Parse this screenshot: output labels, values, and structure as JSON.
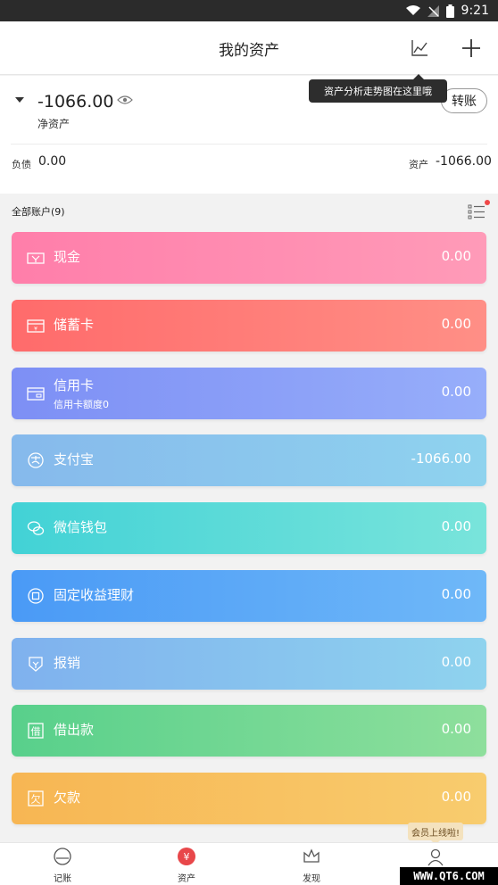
{
  "status_bar": {
    "time": "9:21"
  },
  "header": {
    "title": "我的资产"
  },
  "tooltip": {
    "text": "资产分析走势图在这里哦"
  },
  "summary": {
    "net_amount": "-1066.00",
    "net_label": "净资产",
    "transfer_label": "转账",
    "debt_label": "负债",
    "debt_value": "0.00",
    "asset_label": "资产",
    "asset_value": "-1066.00"
  },
  "accounts_header": {
    "title": "全部账户(9)"
  },
  "accounts": [
    {
      "name": "现金",
      "value": "0.00",
      "icon": "cash-icon",
      "color_start": "#ff7eaa",
      "color_end": "#ff9bb8"
    },
    {
      "name": "储蓄卡",
      "value": "0.00",
      "icon": "savings-card-icon",
      "color_start": "#ff6b6b",
      "color_end": "#ff8f86"
    },
    {
      "name": "信用卡",
      "subtitle": "信用卡额度0",
      "value": "0.00",
      "icon": "credit-card-icon",
      "color_start": "#7d8ff5",
      "color_end": "#97aefa"
    },
    {
      "name": "支付宝",
      "value": "-1066.00",
      "icon": "alipay-icon",
      "color_start": "#86b9ec",
      "color_end": "#8fd3ee"
    },
    {
      "name": "微信钱包",
      "value": "0.00",
      "icon": "wechat-icon",
      "color_start": "#42d2d6",
      "color_end": "#79e4db"
    },
    {
      "name": "固定收益理财",
      "value": "0.00",
      "icon": "fixed-income-icon",
      "color_start": "#4a9af6",
      "color_end": "#6fb8f8"
    },
    {
      "name": "报销",
      "value": "0.00",
      "icon": "reimburse-icon",
      "color_start": "#7fb1ee",
      "color_end": "#8fd3ee"
    },
    {
      "name": "借出款",
      "value": "0.00",
      "icon": "loan-out-icon",
      "color_start": "#58d08b",
      "color_end": "#8edf9c"
    },
    {
      "name": "欠款",
      "value": "0.00",
      "icon": "debt-icon",
      "color_start": "#f7b653",
      "color_end": "#f8cc6e"
    }
  ],
  "member_tip": {
    "text": "会员上线啦!"
  },
  "tabs": [
    {
      "label": "记账",
      "icon": "bookkeeping-icon"
    },
    {
      "label": "资产",
      "icon": "assets-yen-icon",
      "active": true
    },
    {
      "label": "发现",
      "icon": "crown-icon"
    },
    {
      "label": "",
      "icon": "user-icon"
    }
  ],
  "watermark": {
    "text": "WWW.QT6.COM"
  }
}
